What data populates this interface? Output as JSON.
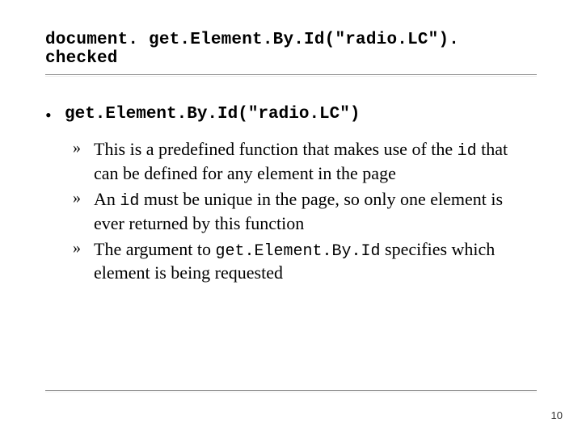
{
  "title": "document. get.Element.By.Id(\"radio.LC\"). checked",
  "bullets": {
    "lvl1": {
      "label": "get.Element.By.Id(\"radio.LC\")"
    },
    "lvl2": [
      {
        "pre": "This is a predefined function that makes use of the ",
        "code": "id",
        "post": " that can be defined for any element in the page"
      },
      {
        "pre": "An ",
        "code": "id",
        "post": " must be unique in the page, so only one element is ever returned by this function"
      },
      {
        "pre": "The argument to ",
        "code": "get.Element.By.Id",
        "post": " specifies which element is being requested"
      }
    ]
  },
  "page_number": "10",
  "glyphs": {
    "bullet1": "•",
    "bullet2": "»"
  }
}
